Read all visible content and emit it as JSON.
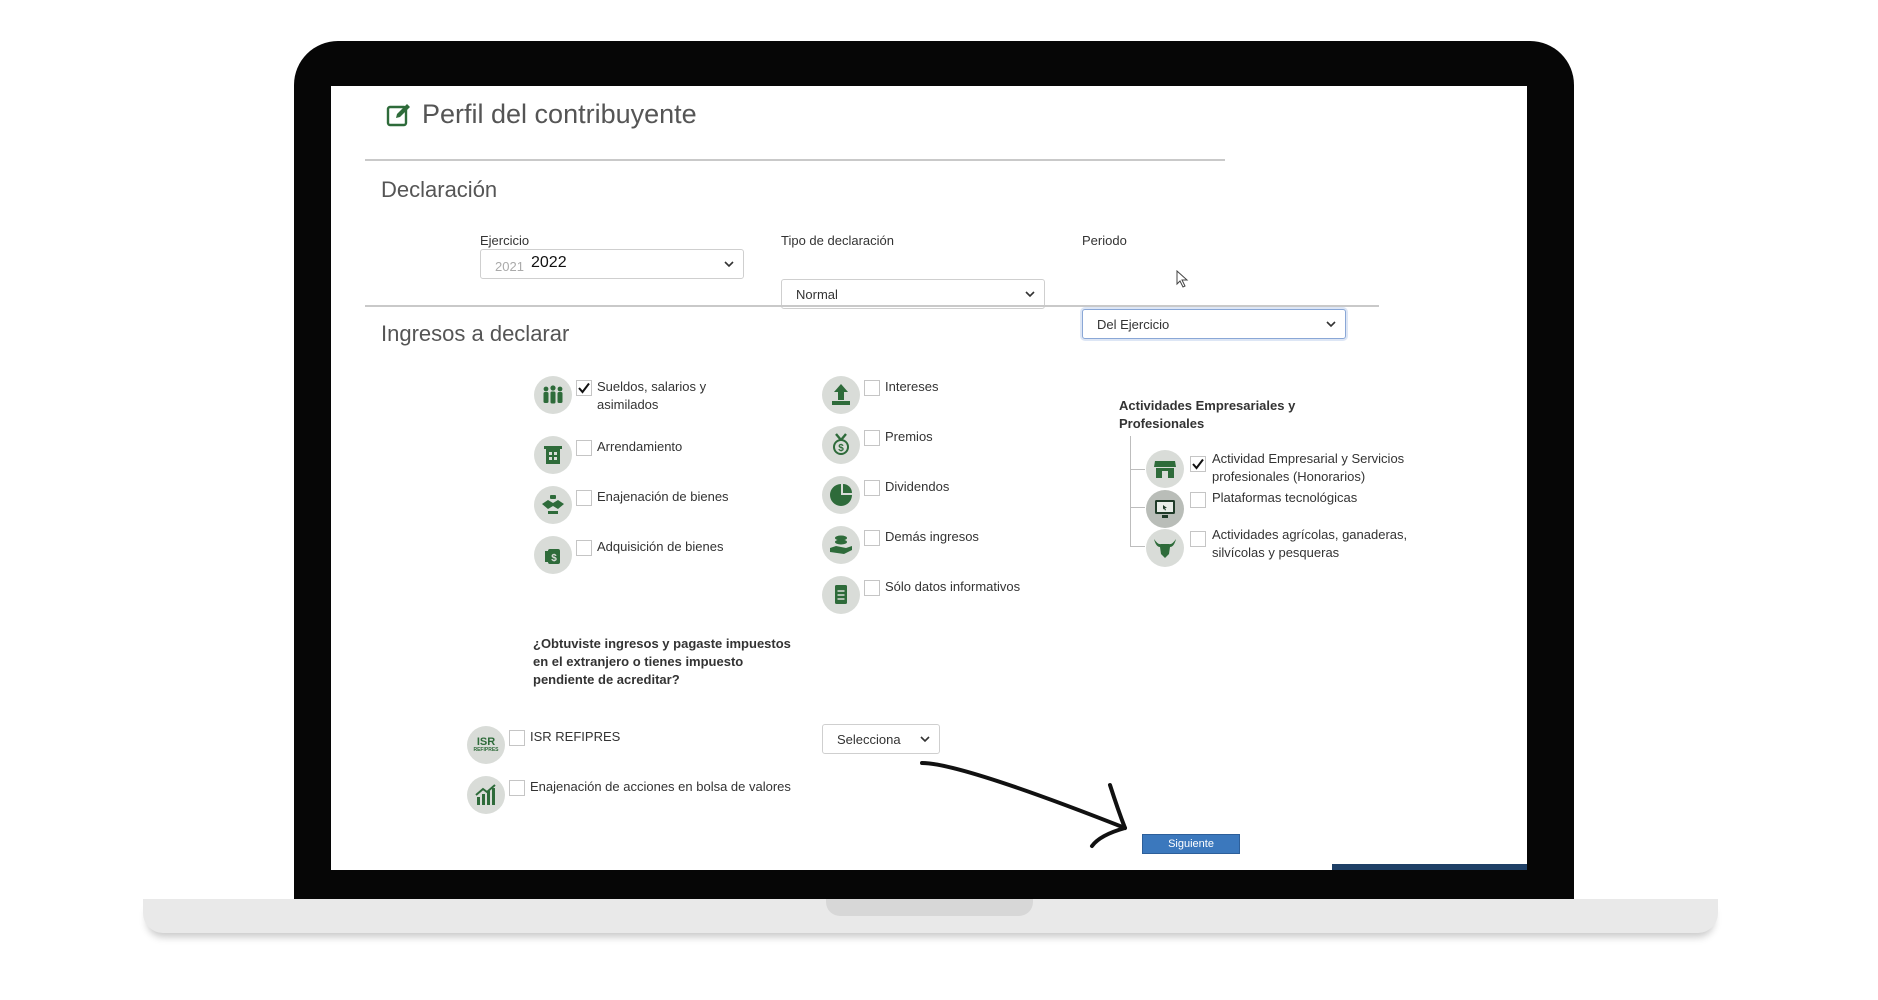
{
  "page": {
    "title": "Perfil del contribuyente"
  },
  "declaracion": {
    "section_title": "Declaración",
    "ejercicio": {
      "label": "Ejercicio",
      "value": "2022",
      "faded_value": "2021"
    },
    "tipo": {
      "label": "Tipo de declaración",
      "value": "Normal"
    },
    "periodo": {
      "label": "Periodo",
      "value": "Del Ejercicio"
    }
  },
  "ingresos": {
    "section_title": "Ingresos a declarar",
    "col1": [
      {
        "label_line1": "Sueldos, salarios y",
        "label_line2": "asimilados",
        "checked": true,
        "icon": "workers-icon"
      },
      {
        "label_line1": "Arrendamiento",
        "label_line2": "",
        "checked": false,
        "icon": "building-icon"
      },
      {
        "label_line1": "Enajenación de bienes",
        "label_line2": "",
        "checked": false,
        "icon": "handshake-icon"
      },
      {
        "label_line1": "Adquisición de bienes",
        "label_line2": "",
        "checked": false,
        "icon": "money-bag-icon"
      }
    ],
    "col2": [
      {
        "label": "Intereses",
        "checked": false,
        "icon": "growth-arrow-icon"
      },
      {
        "label": "Premios",
        "checked": false,
        "icon": "medal-icon"
      },
      {
        "label": "Dividendos",
        "checked": false,
        "icon": "pie-chart-icon"
      },
      {
        "label": "Demás ingresos",
        "checked": false,
        "icon": "coins-hand-icon"
      },
      {
        "label": "Sólo datos informativos",
        "checked": false,
        "icon": "document-icon"
      }
    ],
    "actividades": {
      "title_line1": "Actividades Empresariales y",
      "title_line2": "Profesionales",
      "items": [
        {
          "label_line1": "Actividad Empresarial y Servicios",
          "label_line2": "profesionales (Honorarios)",
          "checked": true,
          "icon": "store-icon"
        },
        {
          "label_line1": "Plataformas tecnológicas",
          "label_line2": "",
          "checked": false,
          "icon": "monitor-icon"
        },
        {
          "label_line1": "Actividades agrícolas, ganaderas,",
          "label_line2": "silvícolas y pesqueras",
          "checked": false,
          "icon": "bull-icon"
        }
      ]
    },
    "extranjero": {
      "question_line1": "¿Obtuviste ingresos y pagaste impuestos",
      "question_line2": "en el extranjero o tienes impuesto",
      "question_line3": "pendiente de acreditar?",
      "select_value": "Selecciona"
    },
    "extra": [
      {
        "label": "ISR REFIPRES",
        "checked": false,
        "icon": "isr-refipres-icon",
        "icon_text1": "ISR",
        "icon_text2": "REFIPRES"
      },
      {
        "label": "Enajenación de acciones en bolsa de valores",
        "checked": false,
        "icon": "stock-chart-icon"
      }
    ]
  },
  "actions": {
    "next_label": "Siguiente"
  },
  "colors": {
    "brand_green": "#2e6b3a",
    "button_blue": "#3b78bd",
    "icon_bg": "#d9dcd8"
  }
}
